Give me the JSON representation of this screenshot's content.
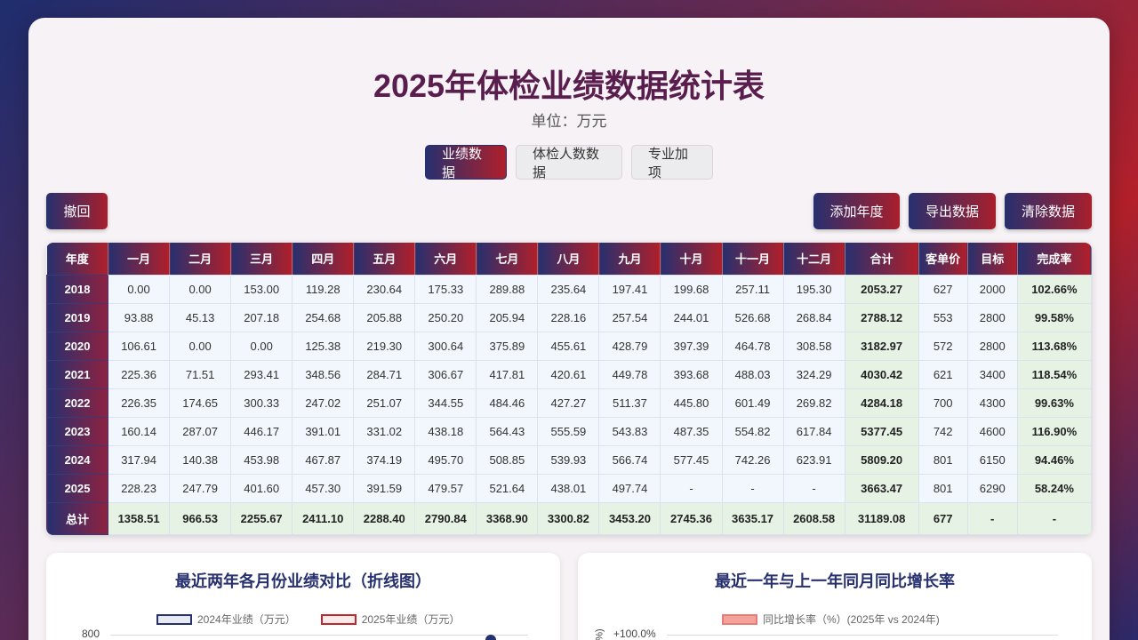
{
  "header": {
    "title": "2025年体检业绩数据统计表",
    "subtitle": "单位：万元"
  },
  "tabs": [
    {
      "label": "业绩数据",
      "active": true
    },
    {
      "label": "体检人数数据",
      "active": false
    },
    {
      "label": "专业加项",
      "active": false
    }
  ],
  "toolbar": {
    "undo_label": "撤回",
    "add_year_label": "添加年度",
    "export_label": "导出数据",
    "clear_label": "清除数据"
  },
  "table": {
    "headers": [
      "年度",
      "一月",
      "二月",
      "三月",
      "四月",
      "五月",
      "六月",
      "七月",
      "八月",
      "九月",
      "十月",
      "十一月",
      "十二月",
      "合计",
      "客单价",
      "目标",
      "完成率"
    ],
    "rows": [
      [
        "2018",
        "0.00",
        "0.00",
        "153.00",
        "119.28",
        "230.64",
        "175.33",
        "289.88",
        "235.64",
        "197.41",
        "199.68",
        "257.11",
        "195.30",
        "2053.27",
        "627",
        "2000",
        "102.66%"
      ],
      [
        "2019",
        "93.88",
        "45.13",
        "207.18",
        "254.68",
        "205.88",
        "250.20",
        "205.94",
        "228.16",
        "257.54",
        "244.01",
        "526.68",
        "268.84",
        "2788.12",
        "553",
        "2800",
        "99.58%"
      ],
      [
        "2020",
        "106.61",
        "0.00",
        "0.00",
        "125.38",
        "219.30",
        "300.64",
        "375.89",
        "455.61",
        "428.79",
        "397.39",
        "464.78",
        "308.58",
        "3182.97",
        "572",
        "2800",
        "113.68%"
      ],
      [
        "2021",
        "225.36",
        "71.51",
        "293.41",
        "348.56",
        "284.71",
        "306.67",
        "417.81",
        "420.61",
        "449.78",
        "393.68",
        "488.03",
        "324.29",
        "4030.42",
        "621",
        "3400",
        "118.54%"
      ],
      [
        "2022",
        "226.35",
        "174.65",
        "300.33",
        "247.02",
        "251.07",
        "344.55",
        "484.46",
        "427.27",
        "511.37",
        "445.80",
        "601.49",
        "269.82",
        "4284.18",
        "700",
        "4300",
        "99.63%"
      ],
      [
        "2023",
        "160.14",
        "287.07",
        "446.17",
        "391.01",
        "331.02",
        "438.18",
        "564.43",
        "555.59",
        "543.83",
        "487.35",
        "554.82",
        "617.84",
        "5377.45",
        "742",
        "4600",
        "116.90%"
      ],
      [
        "2024",
        "317.94",
        "140.38",
        "453.98",
        "467.87",
        "374.19",
        "495.70",
        "508.85",
        "539.93",
        "566.74",
        "577.45",
        "742.26",
        "623.91",
        "5809.20",
        "801",
        "6150",
        "94.46%"
      ],
      [
        "2025",
        "228.23",
        "247.79",
        "401.60",
        "457.30",
        "391.59",
        "479.57",
        "521.64",
        "438.01",
        "497.74",
        "-",
        "-",
        "-",
        "3663.47",
        "801",
        "6290",
        "58.24%"
      ]
    ],
    "total": [
      "总计",
      "1358.51",
      "966.53",
      "2255.67",
      "2411.10",
      "2288.40",
      "2790.84",
      "3368.90",
      "3300.82",
      "3453.20",
      "2745.36",
      "3635.17",
      "2608.58",
      "31189.08",
      "677",
      "-",
      "-"
    ]
  },
  "charts": {
    "left": {
      "title": "最近两年各月份业绩对比（折线图）",
      "legend_2024": "2024年业绩（万元）",
      "legend_2025": "2025年业绩（万元）",
      "y_top_tick": "800"
    },
    "right": {
      "title": "最近一年与上一年同月同比增长率",
      "legend": "同比增长率（%）(2025年 vs 2024年)",
      "y_top_tick": "+100.0%",
      "y_axis_fragment": "%)"
    }
  },
  "colors": {
    "accent_blue": "#27306f",
    "accent_red": "#b01f2a",
    "series_2024": "#27306f",
    "series_2025": "#c0272d",
    "growth_fill": "#f5a19c"
  }
}
